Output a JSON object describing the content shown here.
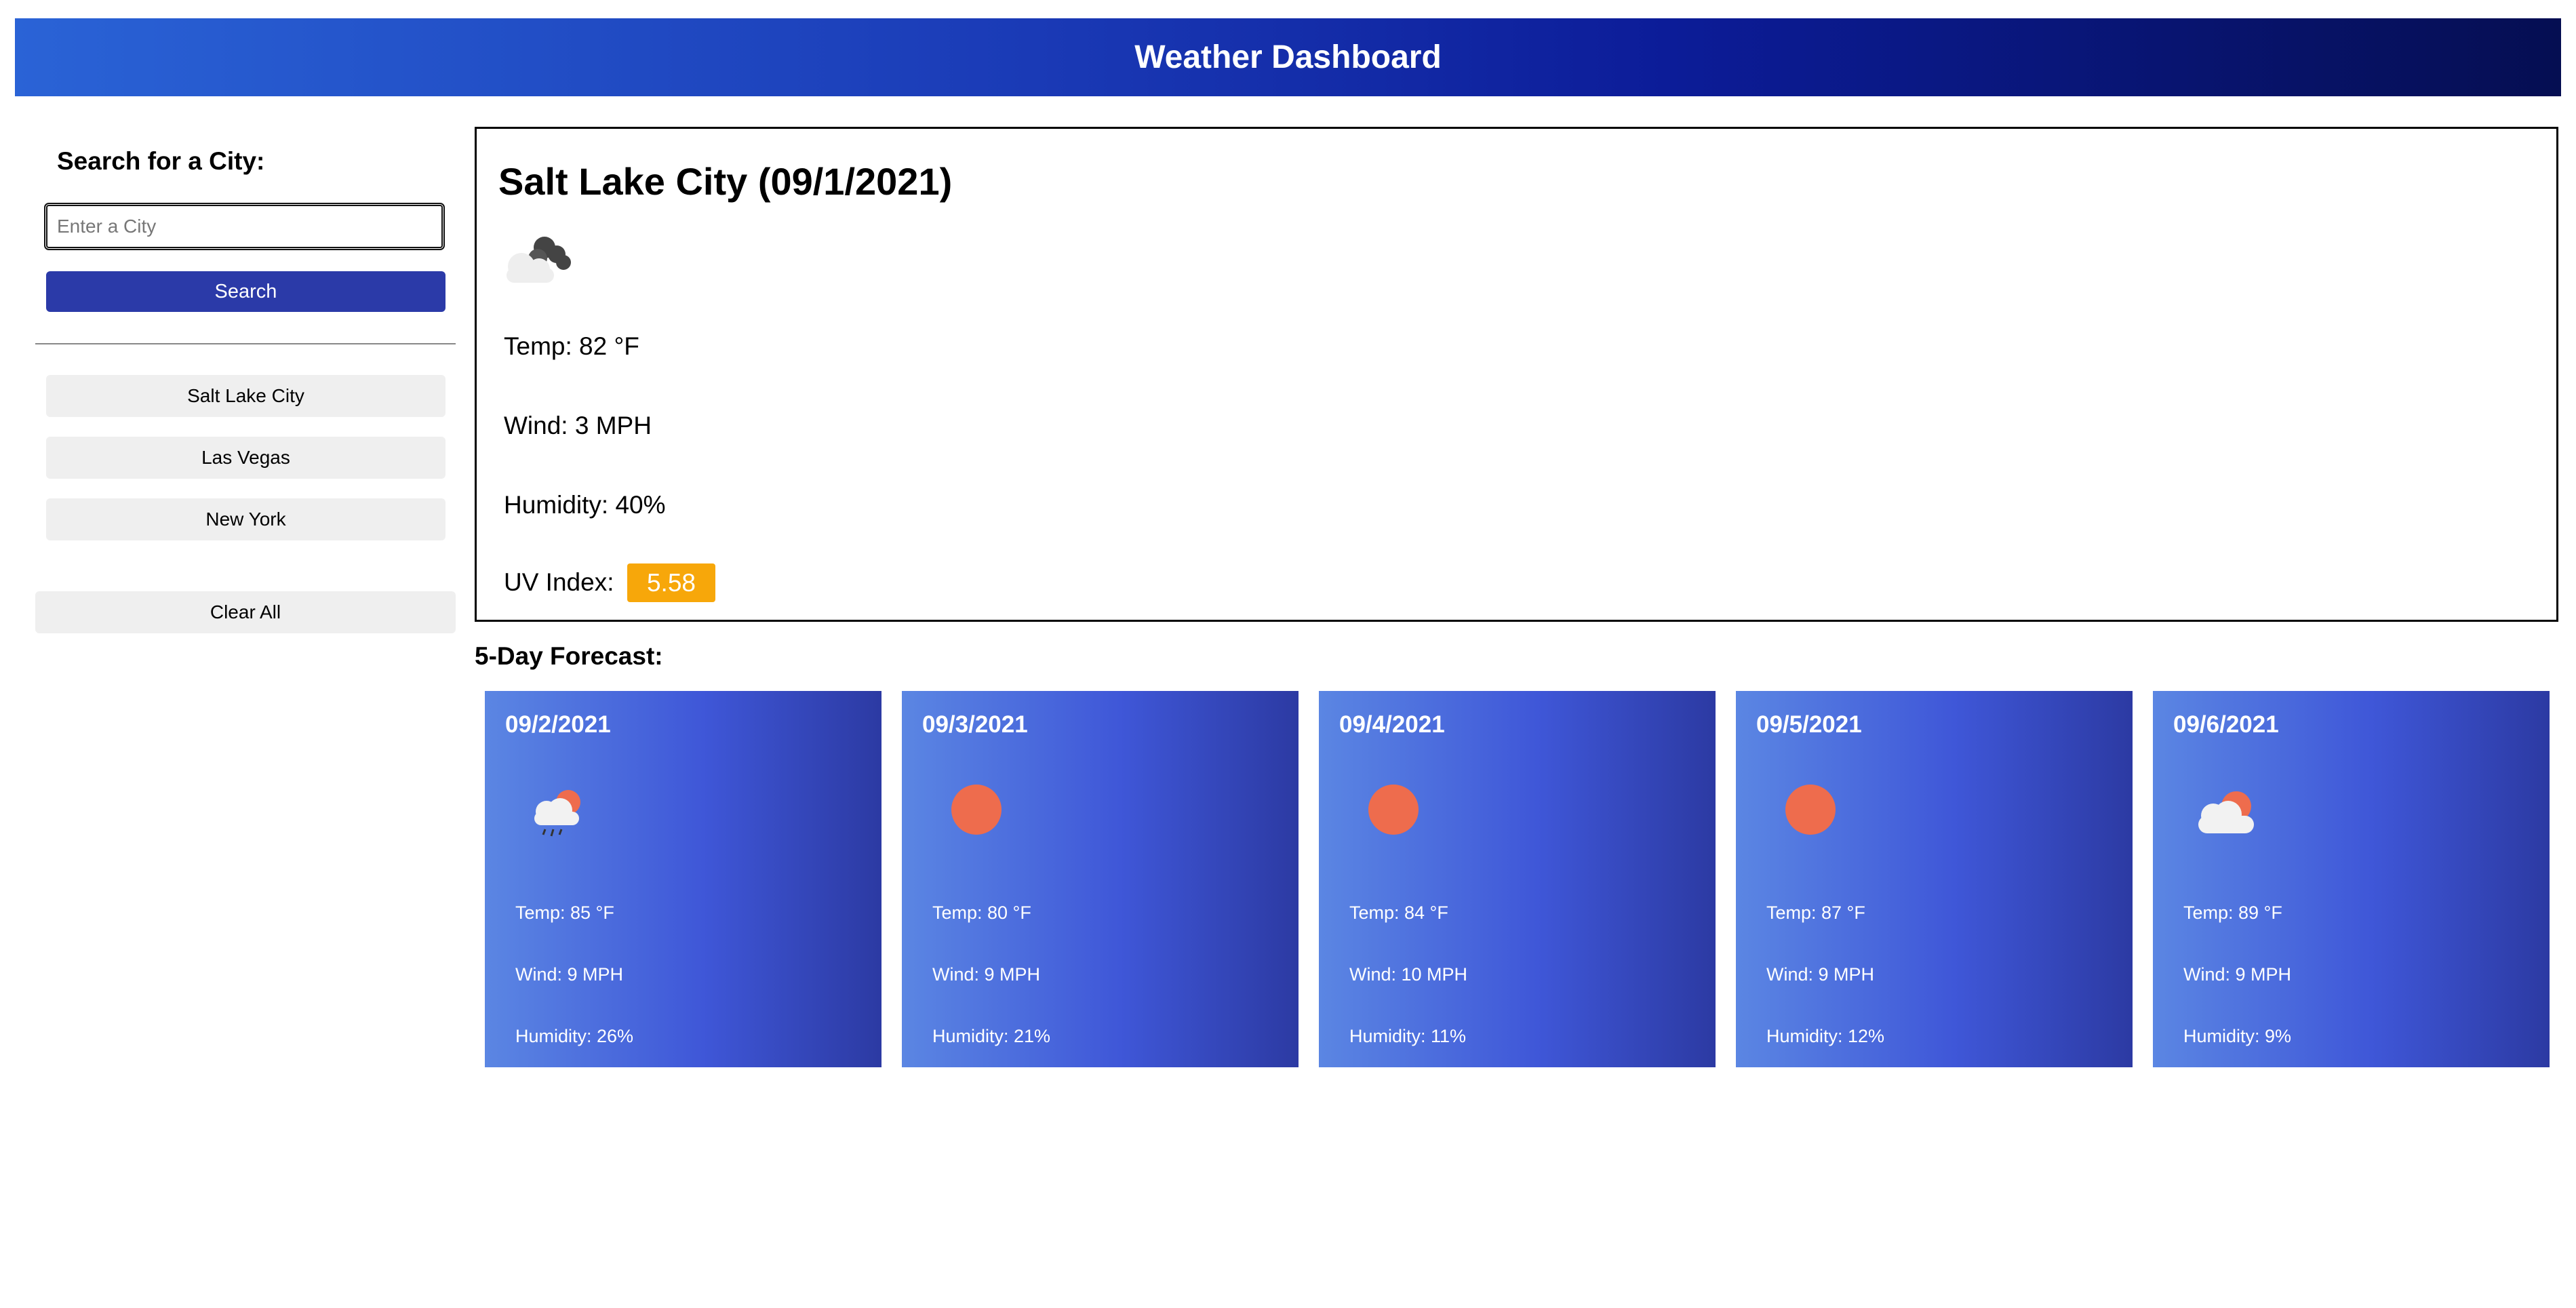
{
  "header": {
    "title": "Weather Dashboard"
  },
  "sidebar": {
    "search_heading": "Search for a City:",
    "input_placeholder": "Enter a City",
    "input_value": "",
    "search_button": "Search",
    "history": [
      "Salt Lake City",
      "Las Vegas",
      "New York"
    ],
    "clear_button": "Clear All"
  },
  "current": {
    "title": "Salt Lake City (09/1/2021)",
    "icon": "broken-clouds-icon",
    "temp": "Temp: 82 °F",
    "wind": "Wind: 3 MPH",
    "humidity": "Humidity: 40%",
    "uv_label": "UV Index:",
    "uv_value": "5.58",
    "uv_color": "#f7a70a"
  },
  "forecast": {
    "heading": "5-Day Forecast:",
    "days": [
      {
        "date": "09/2/2021",
        "icon": "rain-cloud-sun-icon",
        "temp": "Temp: 85 °F",
        "wind": "Wind: 9 MPH",
        "humidity": "Humidity: 26%"
      },
      {
        "date": "09/3/2021",
        "icon": "sun-icon",
        "temp": "Temp: 80 °F",
        "wind": "Wind: 9 MPH",
        "humidity": "Humidity: 21%"
      },
      {
        "date": "09/4/2021",
        "icon": "sun-icon",
        "temp": "Temp: 84 °F",
        "wind": "Wind: 10 MPH",
        "humidity": "Humidity: 11%"
      },
      {
        "date": "09/5/2021",
        "icon": "sun-icon",
        "temp": "Temp: 87 °F",
        "wind": "Wind: 9 MPH",
        "humidity": "Humidity: 12%"
      },
      {
        "date": "09/6/2021",
        "icon": "cloud-sun-icon",
        "temp": "Temp: 89 °F",
        "wind": "Wind: 9 MPH",
        "humidity": "Humidity: 9%"
      }
    ]
  },
  "colors": {
    "header_gradient_start": "#2a63d6",
    "header_gradient_end": "#050e52",
    "search_button": "#2b3aa8",
    "card_gradient_start": "#5b86e3",
    "card_gradient_end": "#2c3aa3",
    "sun": "#ee6c4d"
  }
}
